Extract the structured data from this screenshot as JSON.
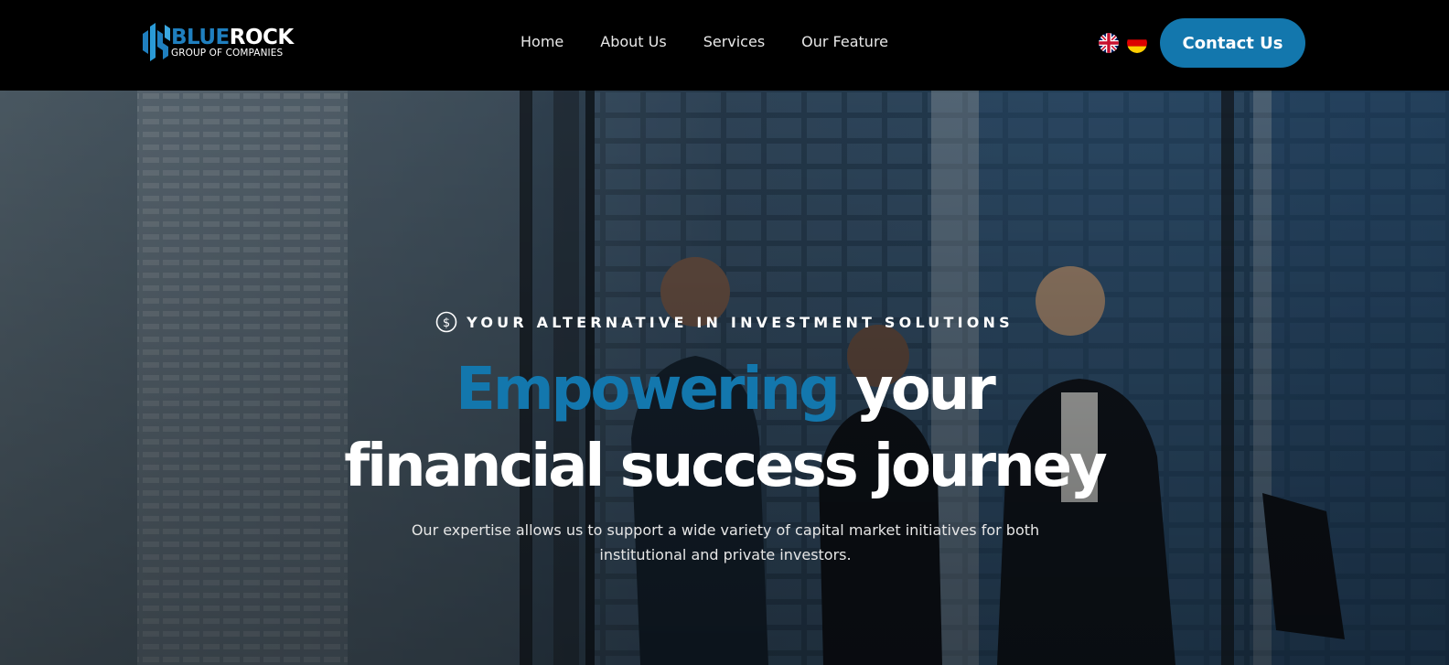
{
  "brand": {
    "name_part1": "BLUE",
    "name_part2": "ROCK",
    "tagline": "GROUP OF COMPANIES",
    "accent_color": "#1377ad"
  },
  "nav": {
    "items": [
      {
        "label": "Home"
      },
      {
        "label": "About Us"
      },
      {
        "label": "Services"
      },
      {
        "label": "Our Feature"
      }
    ]
  },
  "languages": [
    {
      "icon": "uk-flag-icon"
    },
    {
      "icon": "german-flag-icon"
    }
  ],
  "contact_button": {
    "label": "Contact Us"
  },
  "hero": {
    "eyebrow_icon": "dollar-circle-icon",
    "eyebrow": "YOUR ALTERNATIVE IN INVESTMENT SOLUTIONS",
    "headline_accent": "Empowering",
    "headline_rest_line1": " your",
    "headline_line2": "financial success journey",
    "description": "Our expertise allows us to support a wide variety of capital market initiatives for both institutional and private investors."
  }
}
